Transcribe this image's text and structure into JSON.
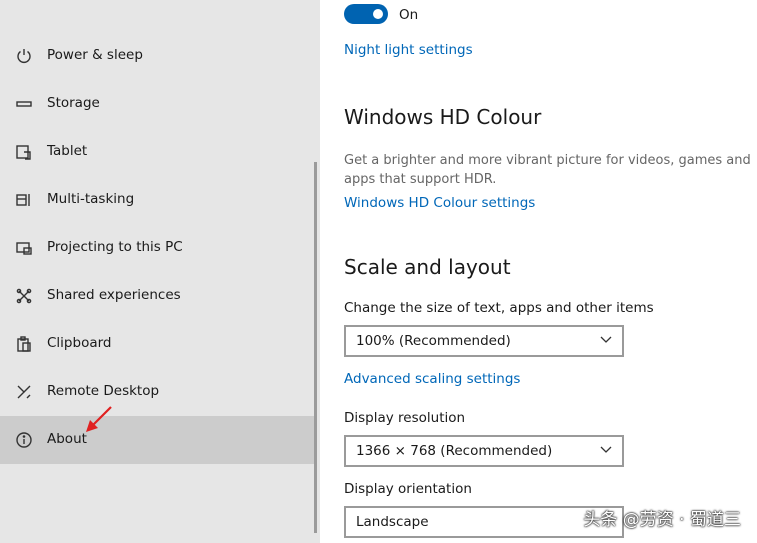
{
  "sidebar": {
    "items": [
      {
        "label": "Power & sleep",
        "icon": "power-icon"
      },
      {
        "label": "Storage",
        "icon": "storage-icon"
      },
      {
        "label": "Tablet",
        "icon": "tablet-icon"
      },
      {
        "label": "Multi-tasking",
        "icon": "multitasking-icon"
      },
      {
        "label": "Projecting to this PC",
        "icon": "projecting-icon"
      },
      {
        "label": "Shared experiences",
        "icon": "shared-experiences-icon"
      },
      {
        "label": "Clipboard",
        "icon": "clipboard-icon"
      },
      {
        "label": "Remote Desktop",
        "icon": "remote-desktop-icon"
      },
      {
        "label": "About",
        "icon": "info-icon",
        "selected": true
      }
    ]
  },
  "night_light": {
    "toggle_state": "On",
    "settings_link": "Night light settings"
  },
  "hdr": {
    "heading": "Windows HD Colour",
    "description": "Get a brighter and more vibrant picture for videos, games and apps that support HDR.",
    "settings_link": "Windows HD Colour settings"
  },
  "scale_layout": {
    "heading": "Scale and layout",
    "size_label": "Change the size of text, apps and other items",
    "size_value": "100% (Recommended)",
    "advanced_link": "Advanced scaling settings",
    "resolution_label": "Display resolution",
    "resolution_value": "1366 × 768 (Recommended)",
    "orientation_label": "Display orientation",
    "orientation_value": "Landscape"
  },
  "watermark": "头条 @劳资 · 蜀道三",
  "colors": {
    "accent": "#0063b1",
    "link": "#0067b8",
    "sidebar_bg": "#e6e6e6",
    "selected_bg": "#cccccc",
    "annotation_arrow": "#e02020"
  }
}
